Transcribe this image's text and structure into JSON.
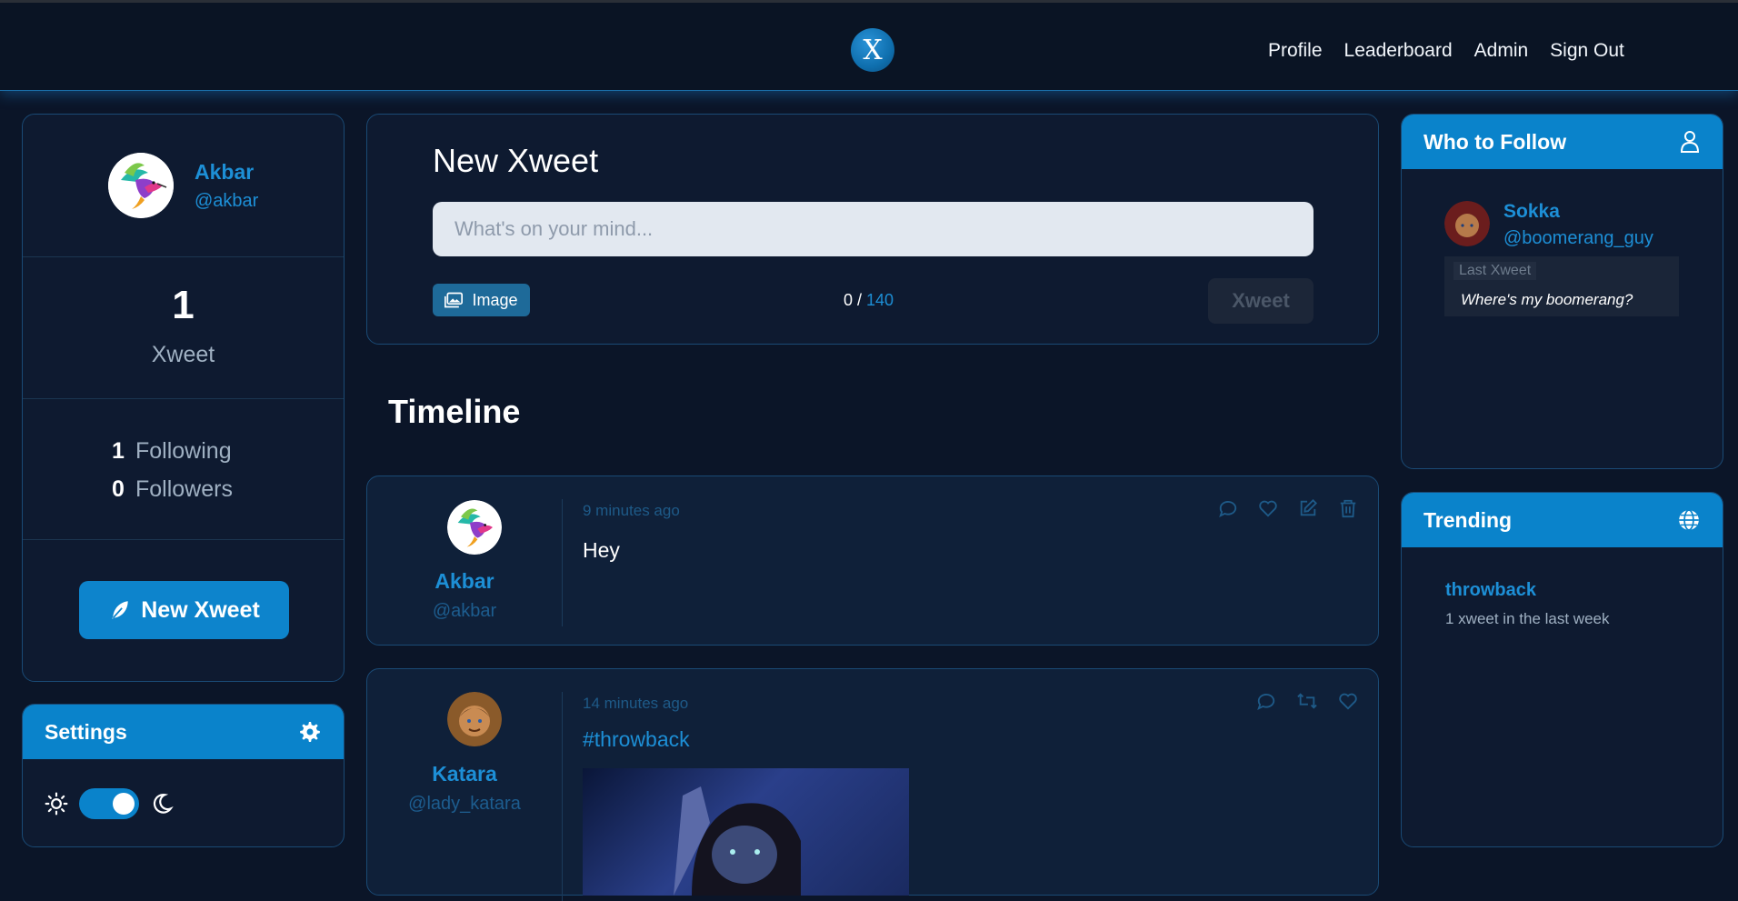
{
  "nav": {
    "logo_letter": "X",
    "links": [
      "Profile",
      "Leaderboard",
      "Admin",
      "Sign Out"
    ]
  },
  "profile": {
    "name": "Akbar",
    "handle": "@akbar",
    "xweet_count": "1",
    "xweet_label": "Xweet",
    "following_count": "1",
    "following_label": "Following",
    "followers_count": "0",
    "followers_label": "Followers",
    "new_xweet_button": "New Xweet"
  },
  "settings": {
    "title": "Settings",
    "dark_mode": true
  },
  "compose": {
    "title": "New Xweet",
    "placeholder": "What's on your mind...",
    "image_button": "Image",
    "count_current": "0",
    "count_sep": " / ",
    "count_max": "140",
    "submit_label": "Xweet"
  },
  "timeline": {
    "title": "Timeline",
    "posts": [
      {
        "author": "Akbar",
        "handle": "@akbar",
        "time": "9 minutes ago",
        "text": "Hey",
        "actions": [
          "comment-icon",
          "heart-icon",
          "edit-icon",
          "trash-icon"
        ]
      },
      {
        "author": "Katara",
        "handle": "@lady_katara",
        "time": "14 minutes ago",
        "text": "#throwback",
        "actions": [
          "comment-icon",
          "retweet-icon",
          "heart-icon"
        ]
      }
    ]
  },
  "who_to_follow": {
    "title": "Who to Follow",
    "suggestion": {
      "name": "Sokka",
      "handle": "@boomerang_guy",
      "last_label": "Last Xweet",
      "last_text": "Where's my boomerang?"
    }
  },
  "trending": {
    "title": "Trending",
    "tag": "throwback",
    "count_text": "1 xweet in the last week"
  },
  "colors": {
    "accent": "#0a83cb",
    "link": "#1d8fd6",
    "background": "#0b1528"
  }
}
